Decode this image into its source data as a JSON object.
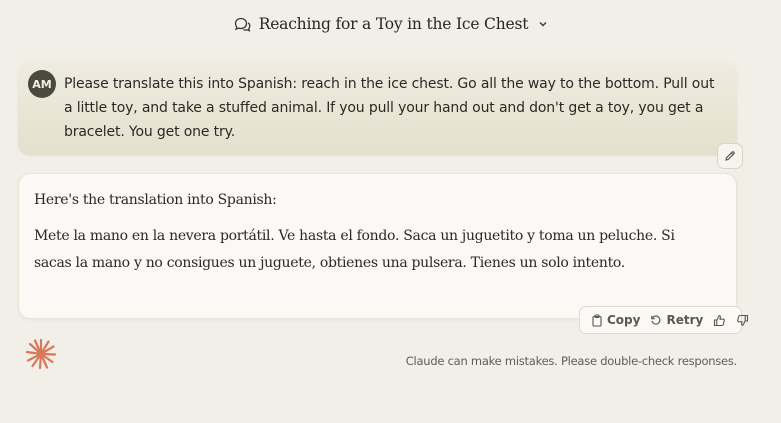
{
  "header": {
    "title": "Reaching for a Toy in the Ice Chest"
  },
  "user_message": {
    "avatar_initials": "AM",
    "text": "Please translate this into Spanish: reach in the ice chest. Go all the way to the bottom. Pull out a little toy, and take a stuffed animal. If you pull your hand out and don't get a toy, you get a bracelet. You get one try."
  },
  "assistant_message": {
    "intro": "Here's the translation into Spanish:",
    "body": "Mete la mano en la nevera portátil. Ve hasta el fondo. Saca un juguetito y toma un peluche. Si sacas la mano y no consigues un juguete, obtienes una pulsera. Tienes un solo intento."
  },
  "actions": {
    "copy_label": "Copy",
    "retry_label": "Retry"
  },
  "footer": {
    "disclaimer": "Claude can make mistakes. Please double-check responses."
  },
  "icons": {
    "chat": "chat-bubbles-icon",
    "chevron": "chevron-down-icon",
    "edit": "pencil-icon",
    "copy": "clipboard-icon",
    "retry": "retry-icon",
    "thumbs_up": "thumbs-up-icon",
    "thumbs_down": "thumbs-down-icon",
    "logo": "claude-logo-icon"
  },
  "colors": {
    "background": "#f1efe8",
    "user_bubble": "#e8e4d3",
    "avatar": "#4a4a3e",
    "logo_accent": "#d97757"
  }
}
